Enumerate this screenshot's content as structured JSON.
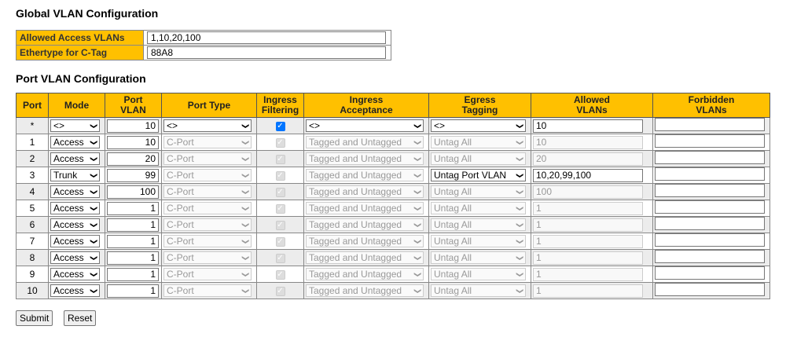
{
  "global": {
    "title": "Global VLAN Configuration",
    "allowed_label": "Allowed Access VLANs",
    "allowed_value": "1,10,20,100",
    "ethertype_label": "Ethertype for C-Tag",
    "ethertype_value": "88A8"
  },
  "port": {
    "title": "Port VLAN Configuration",
    "headers": {
      "port": "Port",
      "mode": "Mode",
      "pvid1": "Port",
      "pvid2": "VLAN",
      "type": "Port Type",
      "ingf1": "Ingress",
      "ingf2": "Filtering",
      "inga1": "Ingress",
      "inga2": "Acceptance",
      "egr1": "Egress",
      "egr2": "Tagging",
      "allow1": "Allowed",
      "allow2": "VLANs",
      "forb1": "Forbidden",
      "forb2": "VLANs"
    },
    "rows": [
      {
        "port": "*",
        "mode": "<>",
        "pvid": "10",
        "type": "<>",
        "filtering": true,
        "acceptance": "<>",
        "egress": "<>",
        "allowed": "10",
        "forbidden": "",
        "active": true
      },
      {
        "port": "1",
        "mode": "Access",
        "pvid": "10",
        "type": "C-Port",
        "filtering": true,
        "acceptance": "Tagged and Untagged",
        "egress": "Untag All",
        "allowed": "10",
        "forbidden": "",
        "active": false
      },
      {
        "port": "2",
        "mode": "Access",
        "pvid": "20",
        "type": "C-Port",
        "filtering": true,
        "acceptance": "Tagged and Untagged",
        "egress": "Untag All",
        "allowed": "20",
        "forbidden": "",
        "active": false
      },
      {
        "port": "3",
        "mode": "Trunk",
        "pvid": "99",
        "type": "C-Port",
        "filtering": true,
        "acceptance": "Tagged and Untagged",
        "egress": "Untag Port VLAN",
        "allowed": "10,20,99,100",
        "forbidden": "",
        "active": false,
        "trunk": true
      },
      {
        "port": "4",
        "mode": "Access",
        "pvid": "100",
        "type": "C-Port",
        "filtering": true,
        "acceptance": "Tagged and Untagged",
        "egress": "Untag All",
        "allowed": "100",
        "forbidden": "",
        "active": false
      },
      {
        "port": "5",
        "mode": "Access",
        "pvid": "1",
        "type": "C-Port",
        "filtering": true,
        "acceptance": "Tagged and Untagged",
        "egress": "Untag All",
        "allowed": "1",
        "forbidden": "",
        "active": false
      },
      {
        "port": "6",
        "mode": "Access",
        "pvid": "1",
        "type": "C-Port",
        "filtering": true,
        "acceptance": "Tagged and Untagged",
        "egress": "Untag All",
        "allowed": "1",
        "forbidden": "",
        "active": false
      },
      {
        "port": "7",
        "mode": "Access",
        "pvid": "1",
        "type": "C-Port",
        "filtering": true,
        "acceptance": "Tagged and Untagged",
        "egress": "Untag All",
        "allowed": "1",
        "forbidden": "",
        "active": false
      },
      {
        "port": "8",
        "mode": "Access",
        "pvid": "1",
        "type": "C-Port",
        "filtering": true,
        "acceptance": "Tagged and Untagged",
        "egress": "Untag All",
        "allowed": "1",
        "forbidden": "",
        "active": false
      },
      {
        "port": "9",
        "mode": "Access",
        "pvid": "1",
        "type": "C-Port",
        "filtering": true,
        "acceptance": "Tagged and Untagged",
        "egress": "Untag All",
        "allowed": "1",
        "forbidden": "",
        "active": false
      },
      {
        "port": "10",
        "mode": "Access",
        "pvid": "1",
        "type": "C-Port",
        "filtering": true,
        "acceptance": "Tagged and Untagged",
        "egress": "Untag All",
        "allowed": "1",
        "forbidden": "",
        "active": false
      }
    ]
  },
  "buttons": {
    "submit": "Submit",
    "reset": "Reset"
  },
  "colors": {
    "header_bg": "#ffc000",
    "checkbox_on": "#0075ff"
  }
}
